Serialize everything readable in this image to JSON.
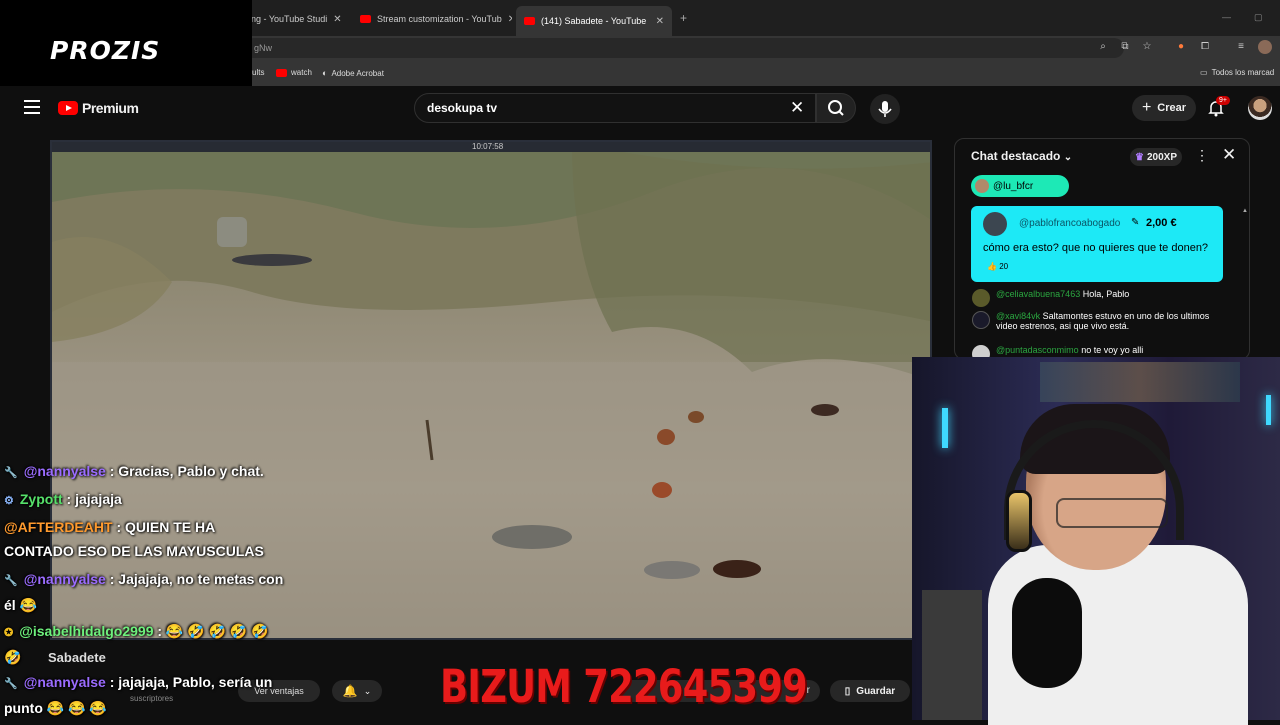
{
  "browser": {
    "tabs": [
      {
        "label": "ning - YouTube Studi"
      },
      {
        "label": "Stream customization - YouTub"
      },
      {
        "label": "(141) Sabadete - YouTube",
        "active": true
      }
    ],
    "url": "gNw",
    "bookmarks": [
      "ults",
      "watch",
      "Adobe Acrobat"
    ],
    "bookmarks_right": "Todos los marcad"
  },
  "overlay": {
    "sponsor_logo": "PROZIS",
    "bizum": "BIZUM 722645399"
  },
  "youtube": {
    "logo_text": "Premium",
    "search_value": "desokupa tv",
    "create_label": "Crear",
    "notif_count": "9+"
  },
  "video": {
    "timestamp": "10:07:58"
  },
  "chat": {
    "title": "Chat destacado",
    "xp": "200XP",
    "pinned_user": "@lu_bfcr",
    "superchat": {
      "author": "@pablofrancoabogado",
      "amount": "2,00 €",
      "message": "cómo era esto? que no quieres que te donen?",
      "likes": "20"
    },
    "messages": [
      {
        "author": "@celiavalbuena7463",
        "text": "Hola, Pablo"
      },
      {
        "author": "@xavi84vk",
        "text": "Saltamontes estuvo en uno de los ultimos video estrenos, asi que vivo está."
      },
      {
        "author": "@puntadasconmimo",
        "text": "no te voy yo alli"
      }
    ]
  },
  "overlay_chat": [
    {
      "author": "@nannyalse",
      "text": ": Gracias, Pablo y chat."
    },
    {
      "author": "Zypott",
      "text": ": jajajaja"
    },
    {
      "author": "@AFTERDEAHT",
      "text": ": QUIEN TE HA CONTADO ESO DE LAS MAYUSCULAS"
    },
    {
      "author": "@nannyalse",
      "text": ": Jajajaja, no te metas con él 😂"
    },
    {
      "author": "@isabelhidalgo2999",
      "text": ": 😂 🤣 🤣 🤣 🤣 🤣"
    },
    {
      "author": "@nannyalse",
      "text": ": jajajaja, Pablo, sería un punto 😂 😂 😂"
    }
  ],
  "below_video": {
    "channel_title": "Sabadete",
    "subscribers": "suscriptores",
    "perks_label": "Ver ventajas",
    "share_label": "rtir",
    "save_label": "Guardar"
  }
}
